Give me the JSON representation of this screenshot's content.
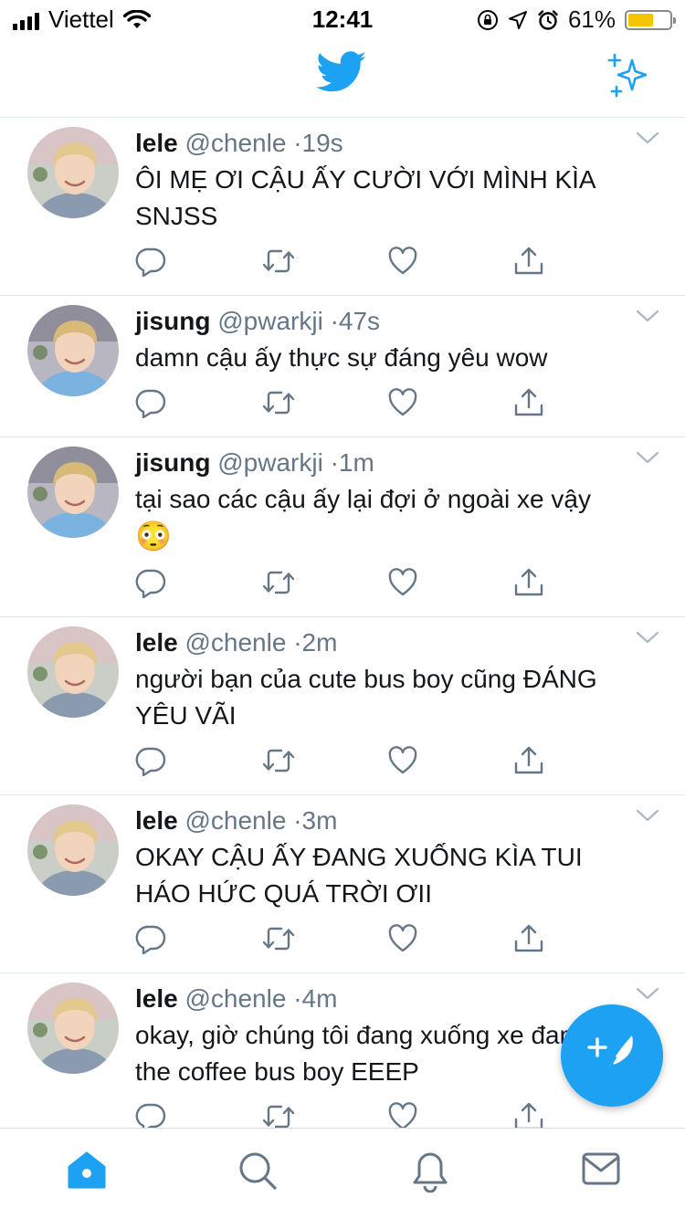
{
  "status_bar": {
    "carrier": "Viettel",
    "time": "12:41",
    "battery_percent": "61%",
    "battery_level": 0.61
  },
  "header": {
    "logo": "twitter-bird-icon",
    "sparkle": "sparkle-icon"
  },
  "colors": {
    "accent": "#1da1f2",
    "secondary_text": "#657786",
    "divider": "#e1e8ed"
  },
  "tweets": [
    {
      "name": "lele",
      "handle": "@chenle",
      "time": "19s",
      "text": "ÔI MẸ ƠI CẬU ẤY CƯỜI VỚI MÌNH KÌA SNJSS",
      "emoji": ""
    },
    {
      "name": "jisung",
      "handle": "@pwarkji",
      "time": "47s",
      "text": "damn cậu ấy thực sự đáng yêu wow",
      "emoji": ""
    },
    {
      "name": "jisung",
      "handle": "@pwarkji",
      "time": "1m",
      "text": "tại sao các cậu ấy lại đợi ở ngoài xe vậy",
      "emoji": "😳"
    },
    {
      "name": "lele",
      "handle": "@chenle",
      "time": "2m",
      "text": "người bạn của cute bus boy cũng ĐÁNG YÊU VÃI",
      "emoji": ""
    },
    {
      "name": "lele",
      "handle": "@chenle",
      "time": "3m",
      "text": "OKAY CẬU ẤY ĐANG XUỐNG KÌA TUI HÁO HỨC QUÁ TRỜI ƠII",
      "emoji": ""
    },
    {
      "name": "lele",
      "handle": "@chenle",
      "time": "4m",
      "text": "okay, giờ chúng tôi đang xuống xe đang đợi the coffee bus boy EEEP",
      "emoji": ""
    }
  ],
  "tab_bar": [
    "home-icon",
    "search-icon",
    "notifications-icon",
    "messages-icon"
  ],
  "fab": "compose-tweet-icon"
}
